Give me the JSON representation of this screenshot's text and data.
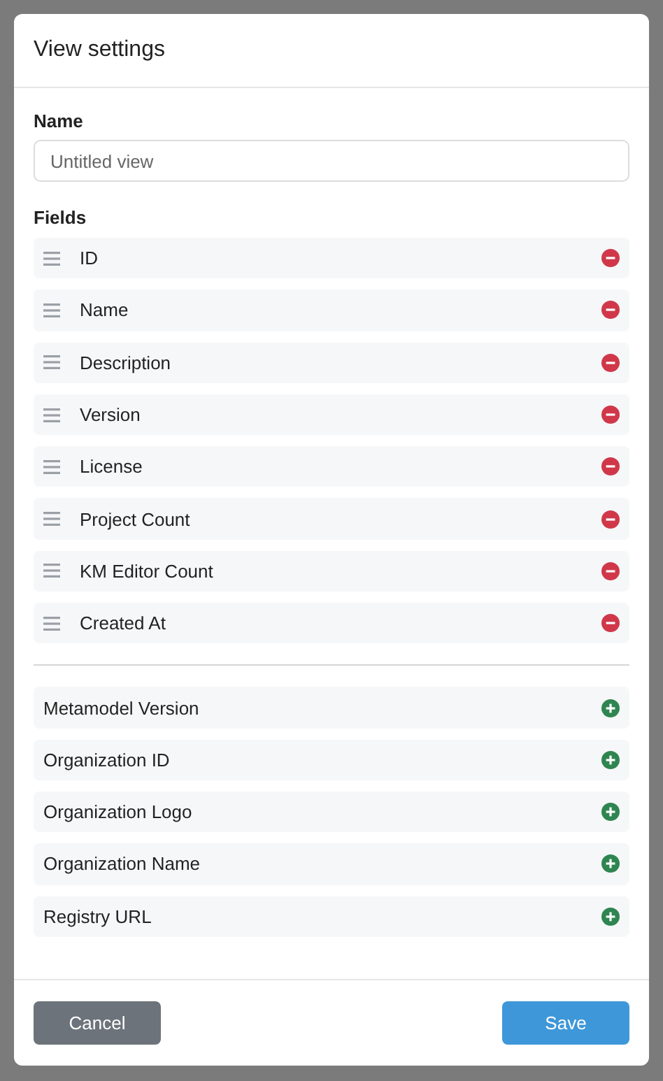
{
  "dialog": {
    "title": "View settings"
  },
  "name_field": {
    "label": "Name",
    "placeholder": "Untitled view"
  },
  "fields": {
    "label": "Fields",
    "items": [
      {
        "label": "ID"
      },
      {
        "label": "Name"
      },
      {
        "label": "Description"
      },
      {
        "label": "Version"
      },
      {
        "label": "License"
      },
      {
        "label": "Project Count"
      },
      {
        "label": "KM Editor Count"
      },
      {
        "label": "Created At"
      }
    ]
  },
  "available_fields": [
    {
      "label": "Metamodel Version"
    },
    {
      "label": "Organization ID"
    },
    {
      "label": "Organization Logo"
    },
    {
      "label": "Organization Name"
    },
    {
      "label": "Registry URL"
    }
  ],
  "buttons": [
    {
      "label": "Cancel",
      "kind": "secondary"
    },
    {
      "label": "Save",
      "kind": "primary"
    }
  ]
}
